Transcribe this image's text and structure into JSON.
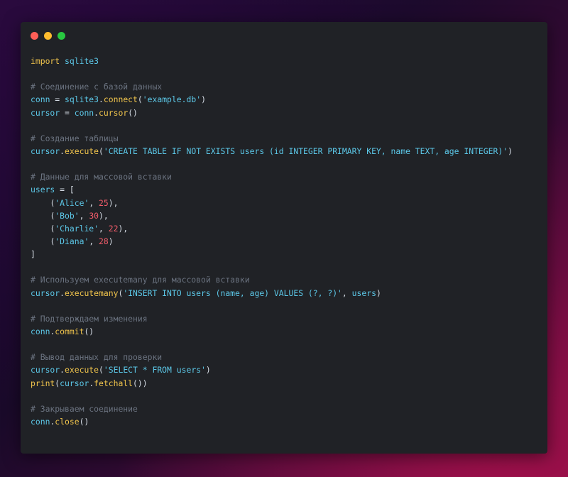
{
  "window": {
    "controls": [
      {
        "name": "close",
        "color": "#ff5f57"
      },
      {
        "name": "minimize",
        "color": "#febc2e"
      },
      {
        "name": "maximize",
        "color": "#28c840"
      }
    ]
  },
  "colors": {
    "keyword": "#f0c44c",
    "identifier": "#5cc8e8",
    "string": "#5cc8e8",
    "number": "#f25c6a",
    "comment": "#6b7380",
    "text": "#d6dde6",
    "editor_background": "#202226"
  },
  "code_lines": [
    [
      [
        "kw",
        "import"
      ],
      [
        "sp",
        " "
      ],
      [
        "var",
        "sqlite3"
      ]
    ],
    [],
    [
      [
        "com",
        "# Соединение с базой данных"
      ]
    ],
    [
      [
        "var",
        "conn"
      ],
      [
        "op",
        " = "
      ],
      [
        "var",
        "sqlite3"
      ],
      [
        "punc",
        "."
      ],
      [
        "fn",
        "connect"
      ],
      [
        "punc",
        "("
      ],
      [
        "str",
        "'example.db'"
      ],
      [
        "punc",
        ")"
      ]
    ],
    [
      [
        "var",
        "cursor"
      ],
      [
        "op",
        " = "
      ],
      [
        "var",
        "conn"
      ],
      [
        "punc",
        "."
      ],
      [
        "fn",
        "cursor"
      ],
      [
        "punc",
        "()"
      ]
    ],
    [],
    [
      [
        "com",
        "# Создание таблицы"
      ]
    ],
    [
      [
        "var",
        "cursor"
      ],
      [
        "punc",
        "."
      ],
      [
        "fn",
        "execute"
      ],
      [
        "punc",
        "("
      ],
      [
        "str",
        "'CREATE TABLE IF NOT EXISTS users (id INTEGER PRIMARY KEY, name TEXT, age INTEGER)'"
      ],
      [
        "punc",
        ")"
      ]
    ],
    [],
    [
      [
        "com",
        "# Данные для массовой вставки"
      ]
    ],
    [
      [
        "var",
        "users"
      ],
      [
        "op",
        " = "
      ],
      [
        "punc",
        "["
      ]
    ],
    [
      [
        "sp",
        "    "
      ],
      [
        "punc",
        "("
      ],
      [
        "str",
        "'Alice'"
      ],
      [
        "punc",
        ", "
      ],
      [
        "num",
        "25"
      ],
      [
        "punc",
        "),"
      ]
    ],
    [
      [
        "sp",
        "    "
      ],
      [
        "punc",
        "("
      ],
      [
        "str",
        "'Bob'"
      ],
      [
        "punc",
        ", "
      ],
      [
        "num",
        "30"
      ],
      [
        "punc",
        "),"
      ]
    ],
    [
      [
        "sp",
        "    "
      ],
      [
        "punc",
        "("
      ],
      [
        "str",
        "'Charlie'"
      ],
      [
        "punc",
        ", "
      ],
      [
        "num",
        "22"
      ],
      [
        "punc",
        "),"
      ]
    ],
    [
      [
        "sp",
        "    "
      ],
      [
        "punc",
        "("
      ],
      [
        "str",
        "'Diana'"
      ],
      [
        "punc",
        ", "
      ],
      [
        "num",
        "28"
      ],
      [
        "punc",
        ")"
      ]
    ],
    [
      [
        "punc",
        "]"
      ]
    ],
    [],
    [
      [
        "com",
        "# Используем executemany для массовой вставки"
      ]
    ],
    [
      [
        "var",
        "cursor"
      ],
      [
        "punc",
        "."
      ],
      [
        "fn",
        "executemany"
      ],
      [
        "punc",
        "("
      ],
      [
        "str",
        "'INSERT INTO users (name, age) VALUES (?, ?)'"
      ],
      [
        "punc",
        ", "
      ],
      [
        "var",
        "users"
      ],
      [
        "punc",
        ")"
      ]
    ],
    [],
    [
      [
        "com",
        "# Подтверждаем изменения"
      ]
    ],
    [
      [
        "var",
        "conn"
      ],
      [
        "punc",
        "."
      ],
      [
        "fn",
        "commit"
      ],
      [
        "punc",
        "()"
      ]
    ],
    [],
    [
      [
        "com",
        "# Вывод данных для проверки"
      ]
    ],
    [
      [
        "var",
        "cursor"
      ],
      [
        "punc",
        "."
      ],
      [
        "fn",
        "execute"
      ],
      [
        "punc",
        "("
      ],
      [
        "str",
        "'SELECT * FROM users'"
      ],
      [
        "punc",
        ")"
      ]
    ],
    [
      [
        "fn",
        "print"
      ],
      [
        "punc",
        "("
      ],
      [
        "var",
        "cursor"
      ],
      [
        "punc",
        "."
      ],
      [
        "fn",
        "fetchall"
      ],
      [
        "punc",
        "())"
      ]
    ],
    [],
    [
      [
        "com",
        "# Закрываем соединение"
      ]
    ],
    [
      [
        "var",
        "conn"
      ],
      [
        "punc",
        "."
      ],
      [
        "fn",
        "close"
      ],
      [
        "punc",
        "()"
      ]
    ]
  ]
}
